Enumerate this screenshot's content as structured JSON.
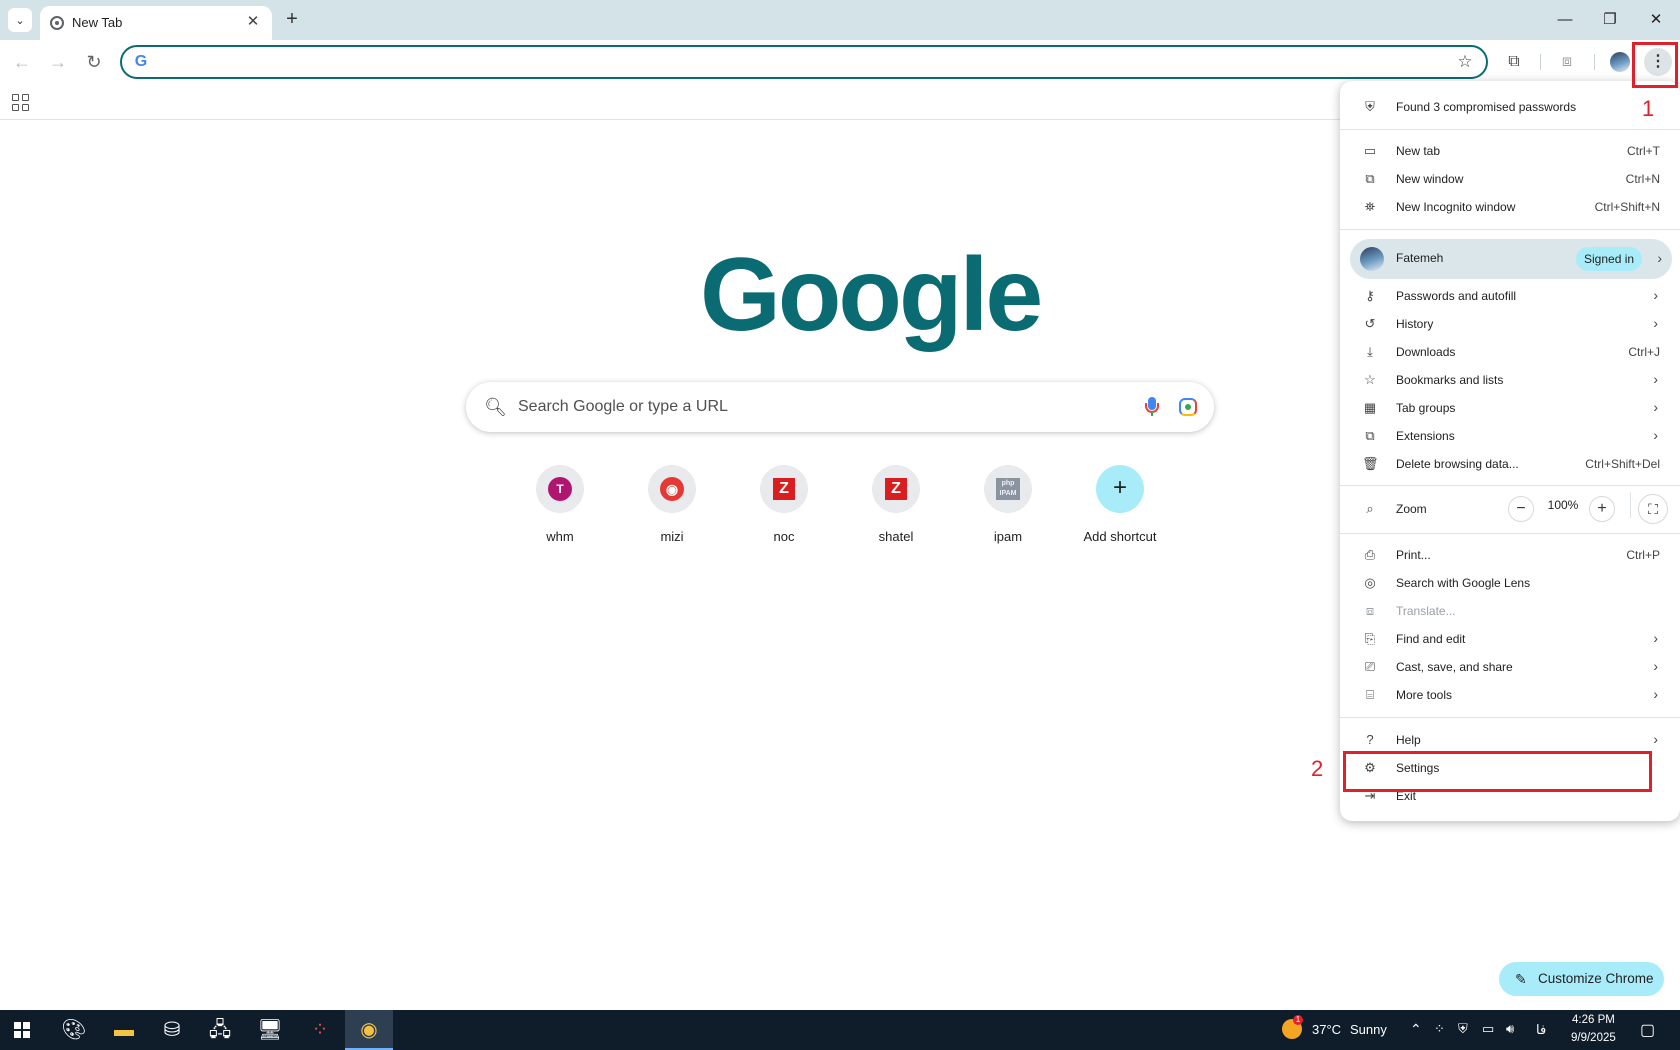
{
  "browser": {
    "tab_title": "New Tab",
    "tab_close": "✕",
    "new_tab": "+",
    "tab_search": "⌄",
    "window_controls": {
      "minimize": "—",
      "restore": "❐",
      "close": "✕"
    },
    "omnibox": {
      "value": "",
      "placeholder": ""
    },
    "toolbar": {
      "back": "←",
      "forward": "→",
      "reload": "↻",
      "bookmark_star": "☆",
      "extensions": "⧉",
      "translate": "⧈",
      "menu": "⋮"
    }
  },
  "ntp": {
    "logo": "Google",
    "search_placeholder": "Search Google or type a URL",
    "shortcuts": [
      {
        "label": "whm",
        "glyph": "T"
      },
      {
        "label": "mizi",
        "glyph": "◉"
      },
      {
        "label": "noc",
        "glyph": "Z"
      },
      {
        "label": "shatel",
        "glyph": "Z"
      },
      {
        "label": "ipam",
        "glyph": "php IPAM"
      },
      {
        "label": "Add shortcut",
        "glyph": "+"
      }
    ],
    "customize_label": "Customize Chrome"
  },
  "menu": {
    "compromised": "Found 3 compromised passwords",
    "new_tab": {
      "label": "New tab",
      "shortcut": "Ctrl+T"
    },
    "new_window": {
      "label": "New window",
      "shortcut": "Ctrl+N"
    },
    "incognito": {
      "label": "New Incognito window",
      "shortcut": "Ctrl+Shift+N"
    },
    "profile": {
      "name": "Fatemeh",
      "status": "Signed in"
    },
    "passwords": "Passwords and autofill",
    "history": "History",
    "downloads": {
      "label": "Downloads",
      "shortcut": "Ctrl+J"
    },
    "bookmarks": "Bookmarks and lists",
    "tab_groups": "Tab groups",
    "extensions": "Extensions",
    "delete_data": {
      "label": "Delete browsing data...",
      "shortcut": "Ctrl+Shift+Del"
    },
    "zoom": {
      "label": "Zoom",
      "value": "100%",
      "minus": "−",
      "plus": "+"
    },
    "print": {
      "label": "Print...",
      "shortcut": "Ctrl+P"
    },
    "lens": "Search with Google Lens",
    "translate": "Translate...",
    "find_edit": "Find and edit",
    "cast": "Cast, save, and share",
    "more_tools": "More tools",
    "help": "Help",
    "settings": "Settings",
    "exit": "Exit"
  },
  "annotations": {
    "one": "1",
    "two": "2",
    "color": "#e0202a"
  },
  "taskbar": {
    "temperature": "37°C",
    "weather": "Sunny",
    "weather_badge": "1",
    "lang": "فا",
    "time": "4:26 PM",
    "date": "9/9/2025"
  },
  "colors": {
    "accent": "#0b6b73",
    "chip": "#a8ecfa",
    "tabstrip": "#d3e3e8"
  }
}
